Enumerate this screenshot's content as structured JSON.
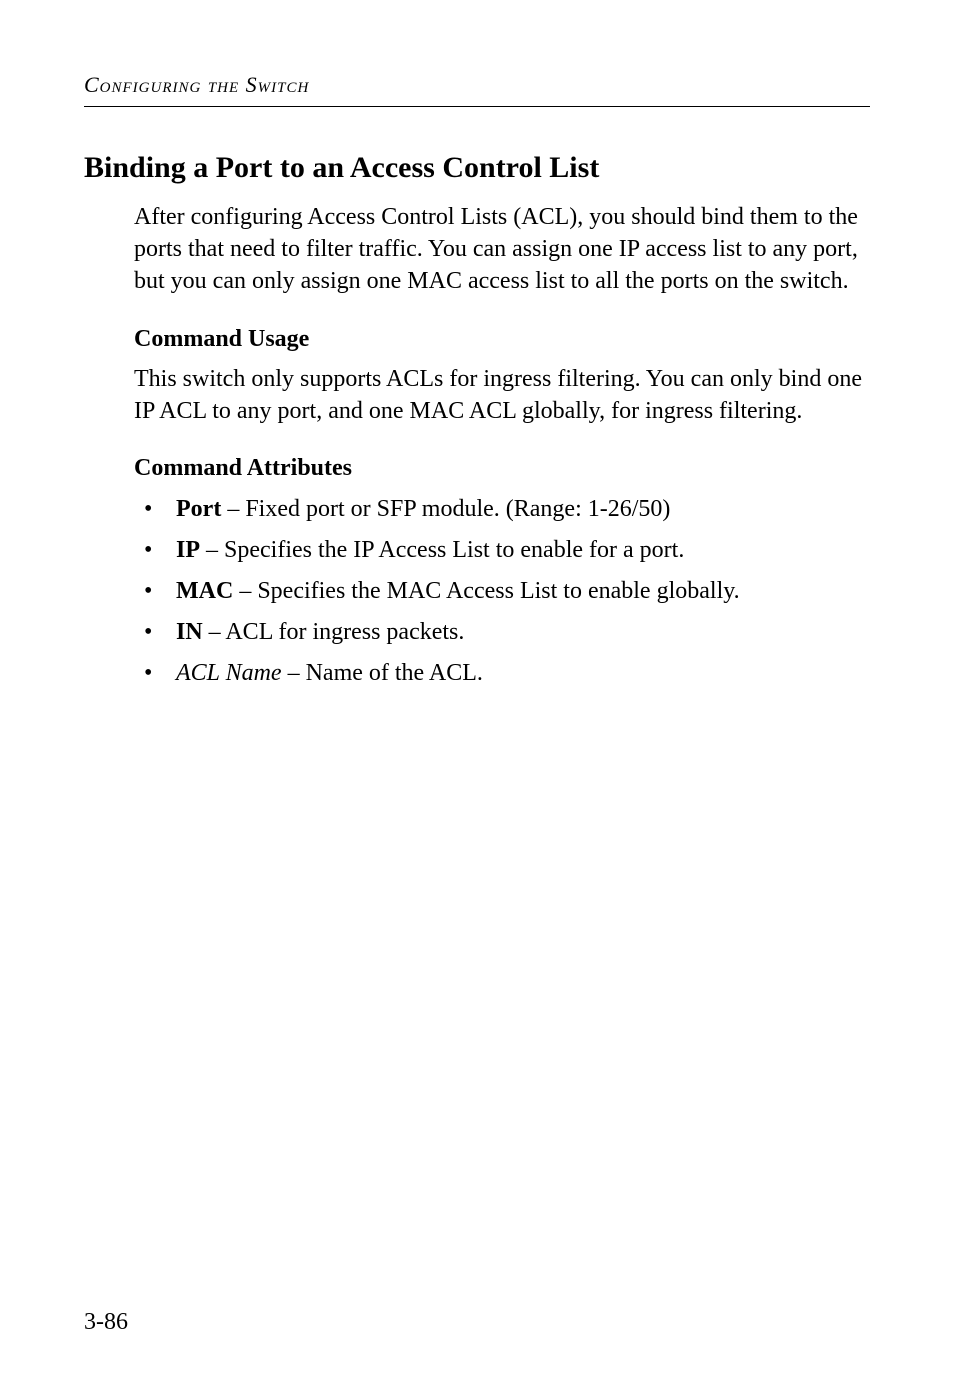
{
  "running_header": "Configuring the Switch",
  "section_heading": "Binding a Port to an Access Control List",
  "intro_paragraph": "After configuring Access Control Lists (ACL), you should bind them to the ports that need to filter traffic. You can assign one IP access list to any port, but you can only assign one MAC access list to all the ports on the switch.",
  "command_usage": {
    "heading": "Command Usage",
    "text": "This switch only supports ACLs for ingress filtering. You can only bind one IP ACL to any port, and one MAC ACL globally, for ingress filtering."
  },
  "command_attributes": {
    "heading": "Command Attributes",
    "items": [
      {
        "term": "Port",
        "term_style": "bold",
        "desc": " – Fixed port or SFP module. (Range: 1-26/50)"
      },
      {
        "term": "IP",
        "term_style": "bold",
        "desc": " – Specifies the IP Access List to enable for a port."
      },
      {
        "term": "MAC",
        "term_style": "bold",
        "desc": " – Specifies the MAC Access List to enable globally."
      },
      {
        "term": "IN",
        "term_style": "bold",
        "desc": " – ACL for ingress packets."
      },
      {
        "term": "ACL Name",
        "term_style": "italic",
        "desc": " – Name of the ACL."
      }
    ]
  },
  "page_number": "3-86"
}
